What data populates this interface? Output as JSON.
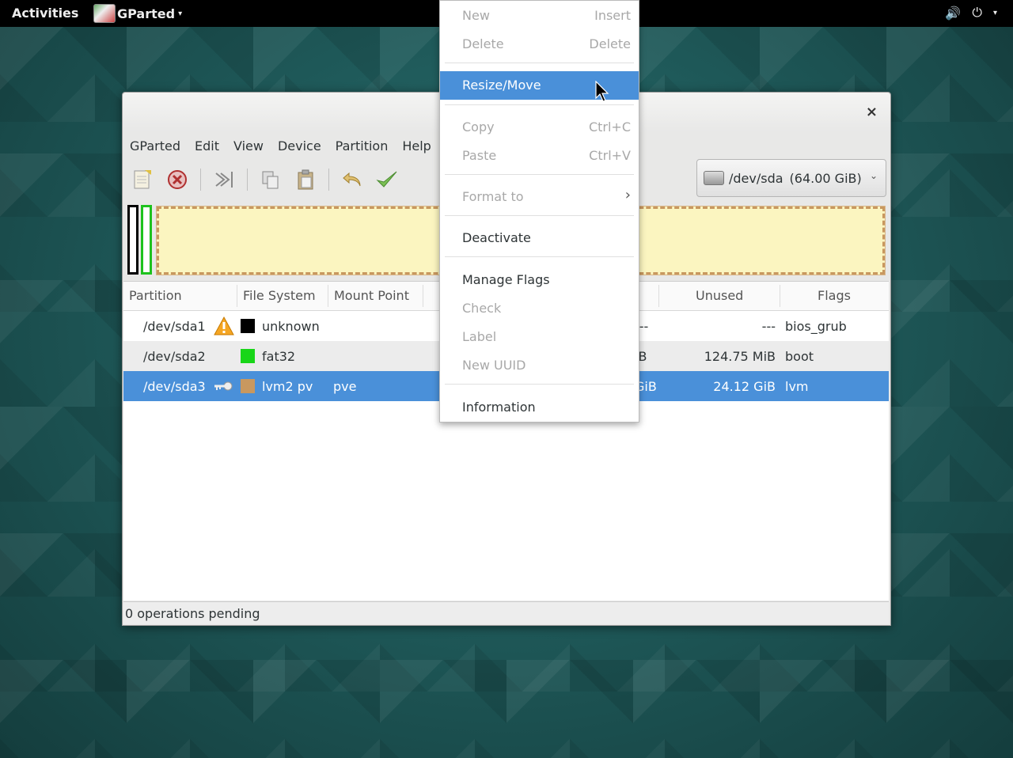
{
  "topbar": {
    "activities": "Activities",
    "app_name": "GParted",
    "app_caret": "▾",
    "volume_icon": "🔊",
    "power_icon": "⏻",
    "power_caret": "▾"
  },
  "window": {
    "close_glyph": "×",
    "menubar": [
      "GParted",
      "Edit",
      "View",
      "Device",
      "Partition",
      "Help"
    ],
    "device_selector": {
      "device": "/dev/sda",
      "size": "(64.00 GiB)"
    },
    "table": {
      "headers": {
        "partition": "Partition",
        "filesystem": "File System",
        "mountpoint": "Mount Point",
        "unused": "Unused",
        "flags": "Flags"
      },
      "rows": [
        {
          "partition": "/dev/sda1",
          "filesystem": "unknown",
          "mount": "",
          "used_tail": "---",
          "unused": "---",
          "flags": "bios_grub",
          "color": "#000000",
          "icon": "warning-icon"
        },
        {
          "partition": "/dev/sda2",
          "filesystem": "fat32",
          "mount": "",
          "used_tail": "iB",
          "unused": "124.75 MiB",
          "flags": "boot",
          "color": "#18d618",
          "icon": ""
        },
        {
          "partition": "/dev/sda3",
          "filesystem": "lvm2 pv",
          "mount": "pve",
          "used_tail": "GiB",
          "unused": "24.12 GiB",
          "flags": "lvm",
          "color": "#c8985f",
          "icon": "key-icon"
        }
      ]
    },
    "status": "0 operations pending"
  },
  "context_menu": {
    "new": {
      "label": "New",
      "accel": "Insert"
    },
    "delete": {
      "label": "Delete",
      "accel": "Delete"
    },
    "resize": {
      "label": "Resize/Move"
    },
    "copy": {
      "label": "Copy",
      "accel": "Ctrl+C"
    },
    "paste": {
      "label": "Paste",
      "accel": "Ctrl+V"
    },
    "format": {
      "label": "Format to",
      "arrow": "›"
    },
    "deactivate": {
      "label": "Deactivate"
    },
    "manage_flags": {
      "label": "Manage Flags"
    },
    "check": {
      "label": "Check"
    },
    "label": {
      "label": "Label"
    },
    "new_uuid": {
      "label": "New UUID"
    },
    "information": {
      "label": "Information"
    }
  }
}
